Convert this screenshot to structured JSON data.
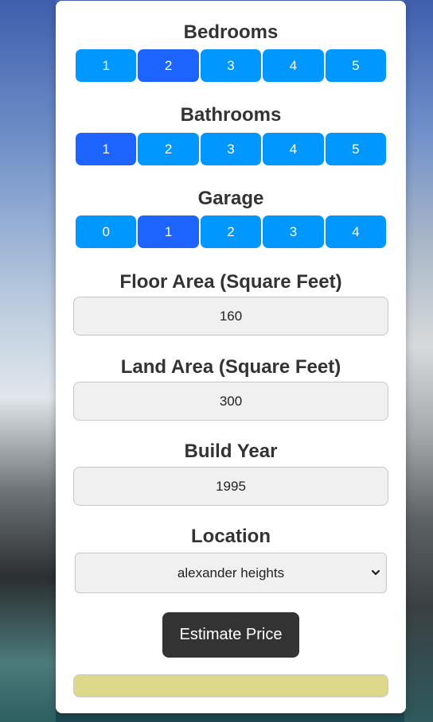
{
  "bedrooms": {
    "title": "Bedrooms",
    "options": [
      "1",
      "2",
      "3",
      "4",
      "5"
    ],
    "selected": "2"
  },
  "bathrooms": {
    "title": "Bathrooms",
    "options": [
      "1",
      "2",
      "3",
      "4",
      "5"
    ],
    "selected": "1"
  },
  "garage": {
    "title": "Garage",
    "options": [
      "0",
      "1",
      "2",
      "3",
      "4"
    ],
    "selected": "1"
  },
  "floor_area": {
    "title": "Floor Area (Square Feet)",
    "value": "160"
  },
  "land_area": {
    "title": "Land Area (Square Feet)",
    "value": "300"
  },
  "build_year": {
    "title": "Build Year",
    "value": "1995"
  },
  "location": {
    "title": "Location",
    "selected": "alexander heights"
  },
  "estimate_button": {
    "label": "Estimate Price"
  },
  "result": {
    "text": ""
  },
  "colors": {
    "button": "#0097ff",
    "button_active": "#1d64ff",
    "estimate_button": "#333333",
    "result_bar": "#ddd88a"
  }
}
